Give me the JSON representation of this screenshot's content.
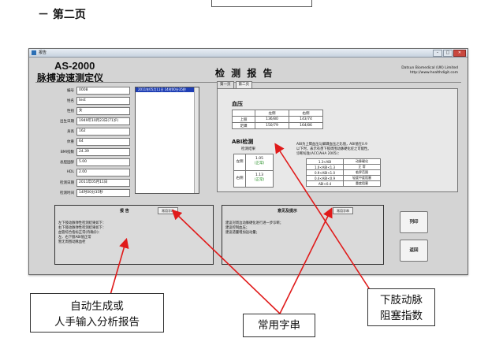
{
  "doc": {
    "heading": "－ 第二页"
  },
  "window": {
    "title": "报告",
    "model": "AS-2000",
    "device_name": "脉搏波速测定仪",
    "report_title": "检 测 报 告",
    "company": [
      "Datsun Biomedical (UK) Limited",
      "http://www.healthdigit.com"
    ],
    "controls": {
      "minimize": "–",
      "maximize": "□",
      "close": "✕"
    }
  },
  "patient_fields": [
    {
      "label": "编号",
      "value": "0008"
    },
    {
      "label": "姓名",
      "value": "test"
    },
    {
      "label": "性别",
      "value": "女"
    },
    {
      "label": "出生日期",
      "value": "1949年10月23日(71岁)"
    },
    {
      "label": "身高",
      "value": "162"
    },
    {
      "label": "体重",
      "value": "64"
    },
    {
      "label": "BMI指数",
      "value": "24.39"
    },
    {
      "label": "总胆固醇",
      "value": "5.00"
    },
    {
      "label": "HDL",
      "value": "2.00"
    },
    {
      "label": "检测日期",
      "value": "2011年05月11日"
    },
    {
      "label": "检测时间",
      "value": "14时00分35秒"
    }
  ],
  "history_list": {
    "selected": "2011年05月11日 14时00分35秒"
  },
  "tabs": [
    "第一页",
    "第二页"
  ],
  "bp": {
    "title": "血压",
    "headers": [
      "",
      "左侧",
      "右侧"
    ],
    "rows": [
      {
        "label": "上肢",
        "left": "136/80",
        "right": "143/74"
      },
      {
        "label": "足踝",
        "left": "150/79",
        "right": "164/86"
      }
    ]
  },
  "abi": {
    "title": "ABI检测",
    "subtitle": "检测结果",
    "left_label": "左侧",
    "left_value": "1.05",
    "left_status": "(正常)",
    "right_label": "右侧",
    "right_value": "1.13",
    "right_status": "(正常)",
    "note": [
      "ABI为上臂血压与脚踝血压之比值，ABI值在0.9",
      "以下时，表示有患下肢周围动脉硬化症之可能性。",
      "诊断标准(ACC/AHA 2005)："
    ],
    "reference": [
      {
        "range": "1.3<ABI",
        "meaning": "动脉硬化"
      },
      {
        "range": "1.0<ABI<1.3",
        "meaning": "正 常"
      },
      {
        "range": "0.9<ABI<1.0",
        "meaning": "临界范围"
      },
      {
        "range": "0.4<ABI<0.9",
        "meaning": "轻度中度阻塞"
      },
      {
        "range": "ABI<0.4",
        "meaning": "重度阻塞"
      }
    ]
  },
  "report_box": {
    "title": "报 告",
    "button": "常用字串",
    "lines": [
      "左下肢动脉弹性检测结果如下：",
      "右下肢动脉弹性检测结果如下：",
      "血管综合指标正常(待确诊)：",
      "左、右下肢ABI值正常",
      "暂无周围动脉血栓"
    ]
  },
  "suggestion_box": {
    "title": "意见及提示",
    "button": "常用字串",
    "lines": [
      "建议对周边动脉硬化进行进一步诊断；",
      "建议控制血压；",
      "建议适量增加运动量；"
    ]
  },
  "side_buttons": {
    "print": "列印",
    "back": "返回"
  },
  "callouts": {
    "report": [
      "自动生成或",
      "人手输入分析报告"
    ],
    "strings": "常用字串",
    "abi": [
      "下肢动脉",
      "阻塞指数"
    ]
  },
  "colors": {
    "arrow": "#e01a1a",
    "window_bg": "#d4d4d4",
    "list_selection": "#1f3fb5",
    "status_green": "#1a8a1a"
  }
}
